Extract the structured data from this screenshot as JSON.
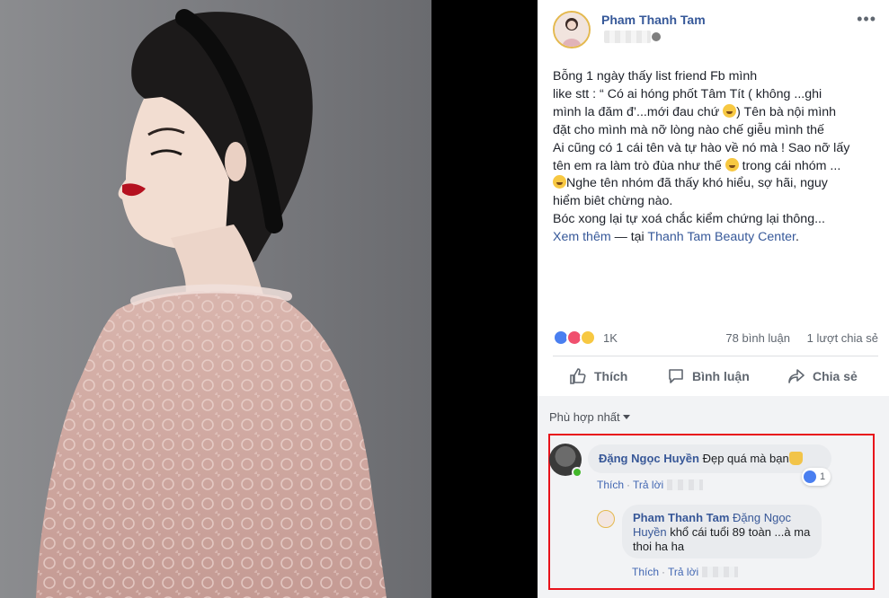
{
  "post": {
    "author": "Pham Thanh Tam",
    "more_glyph": "•••",
    "text_lines": [
      "Bỗng 1 ngày thấy list friend Fb mình",
      "like stt : “ Có ai hóng phốt Tâm Tít ( không ...ghi",
      "mình la đăm đ’...mới đau chứ",
      ") Tên bà nội mình",
      "đặt cho mình mà nỡ lòng nào chế giễu mình thế",
      "Ai cũng có 1 cái tên và tự hào về nó mà ! Sao nỡ lấy",
      "tên em ra làm trò đùa như thế",
      "trong cái nhóm ...",
      "Nghe tên nhóm đã thấy khó hiểu, sợ hãi, nguy",
      "hiểm biêt chừng nào.",
      "Bóc xong lại tự xoá chắc kiểm chứng lại thông..."
    ],
    "see_more": "Xem thêm",
    "separator": " — tại ",
    "place": "Thanh Tam Beauty Center",
    "place_suffix": "."
  },
  "stats": {
    "reactions": "1K",
    "comments": "78 bình luận",
    "shares": "1 lượt chia sẻ"
  },
  "actions": {
    "like": "Thích",
    "comment": "Bình luận",
    "share": "Chia sẻ"
  },
  "comments": {
    "sort_label": "Phù hợp nhất",
    "items": [
      {
        "name": "Đặng Ngọc Huyền",
        "text": "Đẹp quá mà bạn",
        "reaction_count": "1",
        "like": "Thích",
        "reply": "Trả lời"
      },
      {
        "name": "Pham Thanh Tam",
        "mention": "Đặng Ngọc Huyền",
        "text": "khổ cái tuổi 89 toàn ...à ma thoi ha ha",
        "like": "Thích",
        "reply": "Trả lời"
      }
    ]
  },
  "colors": {
    "link": "#365899",
    "highlight_box": "#e8121a",
    "online": "#42b72a"
  }
}
